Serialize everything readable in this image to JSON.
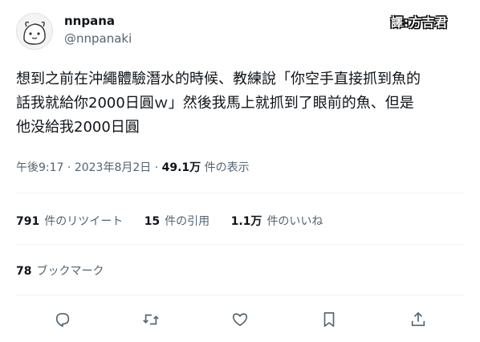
{
  "user": {
    "display_name": "nnpana",
    "handle": "@nnpanaki"
  },
  "watermark": "譯:方吉君",
  "tweet": {
    "lines": [
      "想到之前在沖繩體驗潛水的時候、教練說「你空手直接抓到魚的",
      "話我就給你2000日圓ｗ」然後我馬上就抓到了眼前的魚、但是",
      "他没給我2000日圓"
    ]
  },
  "meta": {
    "time": "午後9:17",
    "separator": "·",
    "date": "2023年8月2日",
    "views_count": "49.1万",
    "views_label": "件の表示"
  },
  "stats": {
    "retweets_count": "791",
    "retweets_label": "件のリツイート",
    "quotes_count": "15",
    "quotes_label": "件の引用",
    "likes_count": "1.1万",
    "likes_label": "件のいいね"
  },
  "bookmarks": {
    "count": "78",
    "label": "ブックマーク"
  },
  "icons": {
    "reply": "reply-icon",
    "retweet": "retweet-icon",
    "like": "heart-icon",
    "bookmark": "bookmark-icon",
    "share": "share-icon"
  },
  "colors": {
    "text": "#0f1419",
    "secondary": "#536471",
    "divider": "#eff3f4"
  }
}
